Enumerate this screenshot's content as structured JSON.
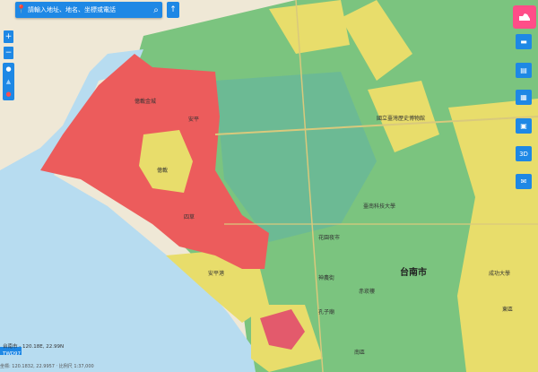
{
  "search": {
    "placeholder": "請輸入地址、地名、坐標或電話"
  },
  "zoom": {
    "in": "+",
    "out": "−"
  },
  "left_tools": [
    "pin",
    "drop",
    "dot"
  ],
  "right_buttons": [
    "comment",
    "chat",
    "layers",
    "monitor",
    "3D",
    "mail"
  ],
  "map_labels": {
    "anping_fort": "億載金城",
    "anping": "安平",
    "tainan_city": "台南市",
    "national_taiwan_history_museum": "國立臺灣歷史博物館",
    "tainan_science": "臺南科技大學",
    "flower_garden": "花園夜市",
    "eternal_fort": "億載",
    "shennong": "神農街",
    "chihkan": "赤崁樓",
    "confucius": "孔子廟",
    "chenggong_univ": "成功大學",
    "east_district": "東區",
    "south_district": "南區",
    "hongyuan": "四草",
    "fishing_port": "安平港"
  },
  "status": {
    "coords": "台南市 - 120.18E, 22.99N",
    "version": "TWD97"
  },
  "footer": {
    "line": "坐標: 120.1832, 22.9957 ‧ 比例尺 1:37,000"
  }
}
